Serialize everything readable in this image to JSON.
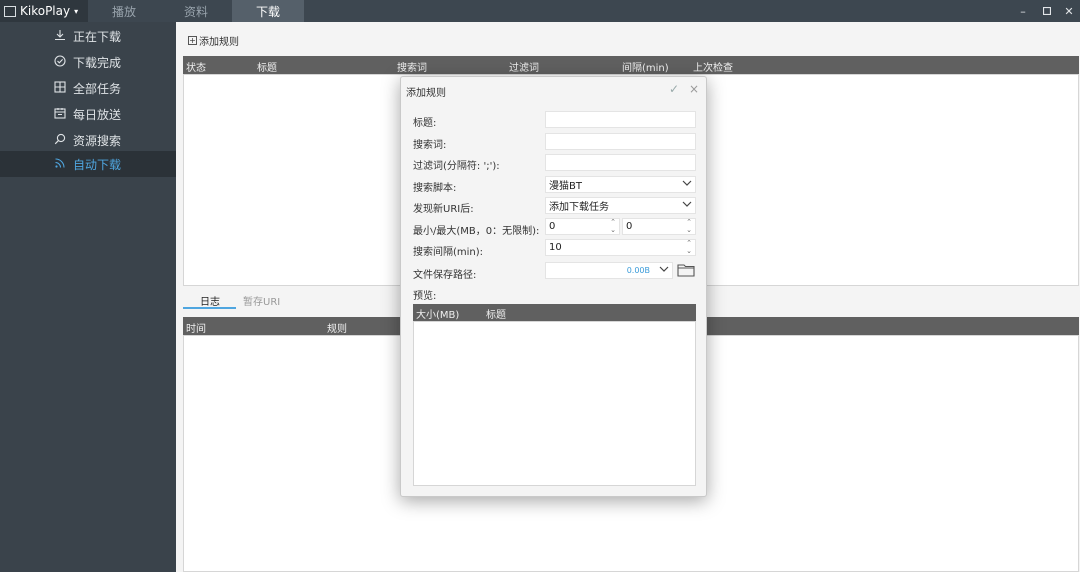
{
  "app": {
    "name": "KikoPlay"
  },
  "tabs": [
    {
      "label": "播放"
    },
    {
      "label": "资料"
    },
    {
      "label": "下载"
    }
  ],
  "sidebar": {
    "items": [
      {
        "label": "正在下载",
        "icon": "download-icon"
      },
      {
        "label": "下载完成",
        "icon": "check-circle-icon"
      },
      {
        "label": "全部任务",
        "icon": "grid-icon"
      },
      {
        "label": "每日放送",
        "icon": "calendar-icon"
      },
      {
        "label": "资源搜索",
        "icon": "search-icon"
      },
      {
        "label": "自动下载",
        "icon": "rss-icon"
      }
    ]
  },
  "main": {
    "add_rule_label": "添加规则",
    "rules_table": {
      "columns": [
        "状态",
        "标题",
        "搜索词",
        "过滤词",
        "间隔(min)",
        "上次检查"
      ]
    },
    "bottom_tabs": [
      "日志",
      "暂存URI"
    ],
    "log_table": {
      "columns": [
        "时间",
        "规则"
      ]
    }
  },
  "dialog": {
    "title": "添加规则",
    "labels": {
      "title": "标题:",
      "search_word": "搜索词:",
      "filter_word": "过滤词(分隔符: ';'):",
      "search_script": "搜索脚本:",
      "on_new_uri": "发现新URI后:",
      "min_max": "最小/最大(MB，0：无限制):",
      "interval": "搜索间隔(min):",
      "save_path": "文件保存路径:",
      "preview": "预览:"
    },
    "values": {
      "title": "",
      "search_word": "",
      "filter_word": "",
      "search_script": "漫猫BT",
      "on_new_uri": "添加下载任务",
      "min": "0",
      "max": "0",
      "interval": "10",
      "save_path": "",
      "free_space": "0.00B"
    },
    "preview_columns": [
      "大小(MB)",
      "标题"
    ]
  },
  "colors": {
    "accent": "#4fa6e0",
    "titlebar": "#3d4750",
    "sidebar": "#3a434b",
    "table_header": "#606060"
  }
}
